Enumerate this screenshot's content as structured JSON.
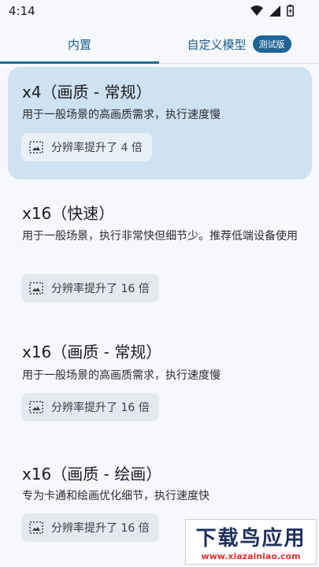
{
  "status_bar": {
    "time": "4:14",
    "icons": [
      "wifi-icon",
      "signal-icon",
      "battery-icon"
    ]
  },
  "tabs": [
    {
      "label": "内置",
      "selected": true
    },
    {
      "label": "自定义模型",
      "badge": "测试版",
      "selected": false
    }
  ],
  "models": [
    {
      "title": "x4（画质 - 常规）",
      "desc": "用于一般场景的高画质需求，执行速度慢",
      "chip": "分辨率提升了 4 倍",
      "selected": true
    },
    {
      "title": "x16（快速）",
      "desc": "用于一般场景，执行非常快但细节少。推荐低端设备使用",
      "chip": "分辨率提升了 16 倍",
      "selected": false
    },
    {
      "title": "x16（画质 - 常规）",
      "desc": "用于一般场景的高画质需求，执行速度慢",
      "chip": "分辨率提升了 16 倍",
      "selected": false
    },
    {
      "title": "x16（画质 - 绘画）",
      "desc": "专为卡通和绘画优化细节，执行速度快",
      "chip": "分辨率提升了 16 倍",
      "selected": false
    }
  ],
  "watermark": {
    "main": "下载鸟应用",
    "sub": "www.xiazainiao.com"
  },
  "colors": {
    "accent": "#1c6f9c",
    "selected_card": "#cfe2f2",
    "badge": "#1f6597"
  }
}
